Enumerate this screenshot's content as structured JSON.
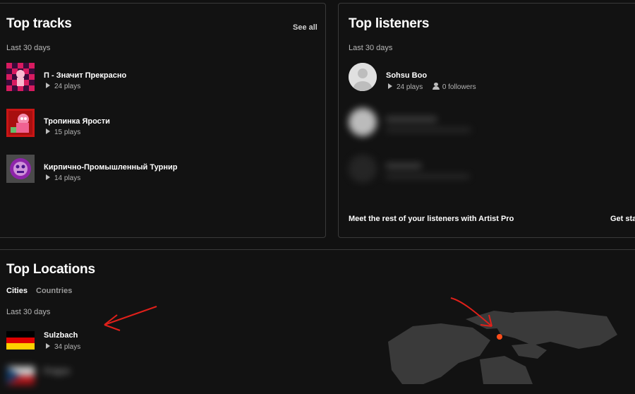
{
  "top_tracks": {
    "title": "Top tracks",
    "see_all": "See all",
    "period": "Last 30 days",
    "items": [
      {
        "name": "П - Значит Прекрасно",
        "plays": "24 plays"
      },
      {
        "name": "Тропинка Ярости",
        "plays": "15 plays"
      },
      {
        "name": "Кирпично-Промышленный Турнир",
        "plays": "14 plays"
      }
    ]
  },
  "top_listeners": {
    "title": "Top listeners",
    "period": "Last 30 days",
    "items": [
      {
        "name": "Sohsu Boo",
        "plays": "24 plays",
        "followers": "0 followers"
      }
    ],
    "promo": "Meet the rest of your listeners with Artist Pro",
    "cta": "Get sta"
  },
  "top_locations": {
    "title": "Top Locations",
    "tabs": [
      "Cities",
      "Countries"
    ],
    "period": "Last 30 days",
    "items": [
      {
        "name": "Sulzbach",
        "plays": "34 plays"
      },
      {
        "name": "Prague"
      }
    ]
  },
  "colors": {
    "accent_arrow": "#e0201a",
    "map_dot": "#ff4d1a"
  }
}
